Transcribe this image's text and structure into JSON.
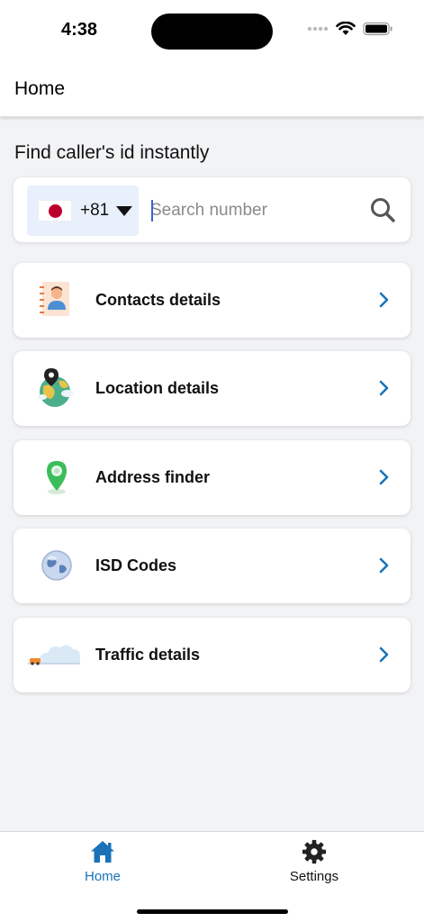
{
  "status_bar": {
    "time": "4:38"
  },
  "header": {
    "title": "Home"
  },
  "search": {
    "heading": "Find caller's id instantly",
    "country_code": "+81",
    "placeholder": "Search number"
  },
  "menu": [
    {
      "label": "Contacts details",
      "icon": "contact-book-icon"
    },
    {
      "label": "Location details",
      "icon": "globe-location-icon"
    },
    {
      "label": "Address finder",
      "icon": "map-pin-icon"
    },
    {
      "label": "ISD Codes",
      "icon": "globe-icon"
    },
    {
      "label": "Traffic details",
      "icon": "traffic-icon"
    }
  ],
  "tabs": [
    {
      "label": "Home",
      "icon": "home-icon",
      "active": true
    },
    {
      "label": "Settings",
      "icon": "gear-icon",
      "active": false
    }
  ],
  "colors": {
    "accent": "#1a73b8",
    "chevron": "#1a73b8",
    "background": "#f2f3f5",
    "picker_bg": "#e8f0fc",
    "flag_red": "#bc002d"
  }
}
